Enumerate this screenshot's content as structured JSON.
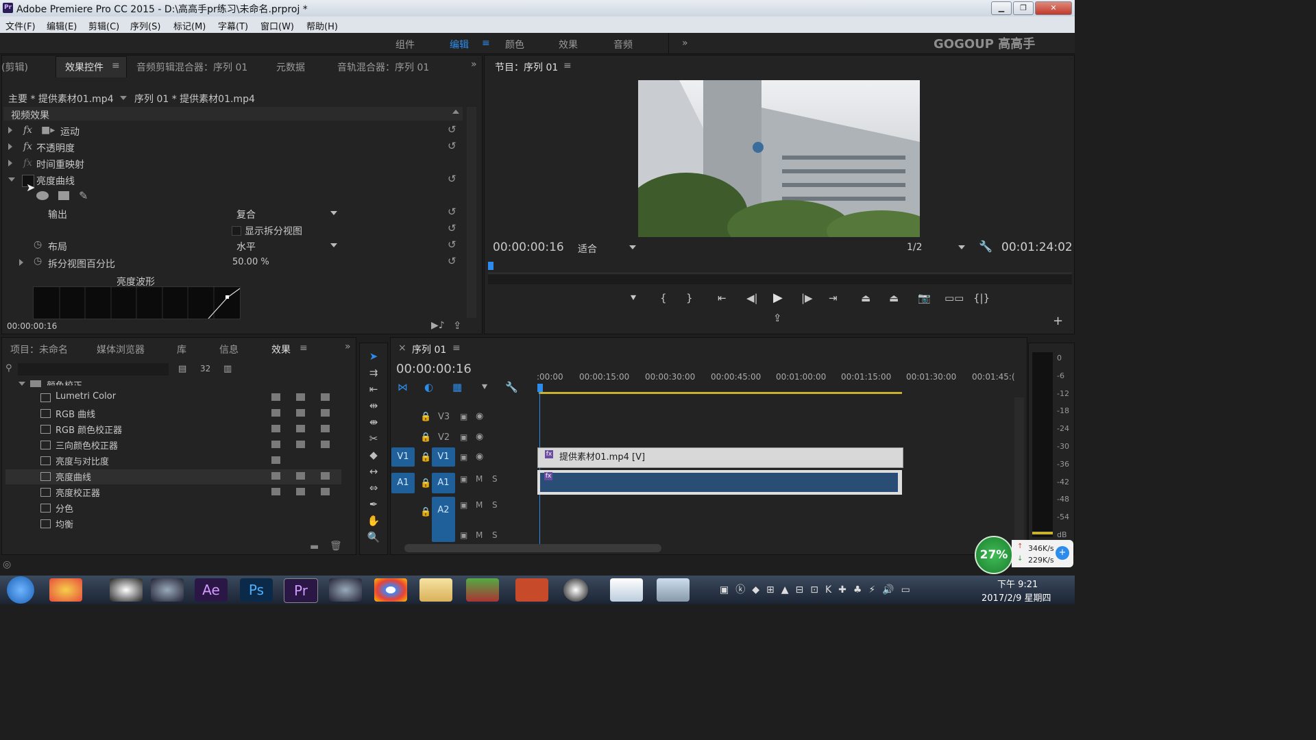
{
  "window": {
    "app_icon": "Pr",
    "title": "Adobe Premiere Pro CC 2015 - D:\\高高手pr练习\\未命名.prproj *",
    "controls": [
      "minimize-icon",
      "restore-icon",
      "close-icon"
    ]
  },
  "menu": [
    "文件(F)",
    "编辑(E)",
    "剪辑(C)",
    "序列(S)",
    "标记(M)",
    "字幕(T)",
    "窗口(W)",
    "帮助(H)"
  ],
  "workspaces": {
    "items": [
      "组件",
      "编辑",
      "颜色",
      "效果",
      "音频"
    ],
    "active": "编辑",
    "overflow": "»",
    "logo": "GOGOUP 高高手"
  },
  "effect_controls": {
    "tabs": [
      "(剪辑)",
      "效果控件",
      "音频剪辑混合器：序列 01",
      "元数据",
      "音轨混合器：序列 01"
    ],
    "selected_tab": "效果控件",
    "overflow": "»",
    "master_clip": "主要 * 提供素材01.mp4",
    "sequence_clip": "序列 01 * 提供素材01.mp4",
    "section": "视频效果",
    "effects": [
      "运动",
      "不透明度",
      "时间重映射",
      "亮度曲线"
    ],
    "fx_label": "fx",
    "props": {
      "output_label": "输出",
      "output_value": "复合",
      "split_view_label": "显示拆分视图",
      "layout_label": "布局",
      "layout_value": "水平",
      "split_percent_label": "拆分视图百分比",
      "split_percent_value": "50.00 %",
      "waveform_label": "亮度波形"
    },
    "timecode": "00:00:00:16"
  },
  "program_monitor": {
    "title": "节目：序列 01",
    "timecode": "00:00:00:16",
    "fit": "适合",
    "resolution": "1/2",
    "duration": "00:01:24:02"
  },
  "project_panel": {
    "tabs": [
      "项目：未命名",
      "媒体浏览器",
      "库",
      "信息",
      "效果"
    ],
    "selected_tab": "效果",
    "overflow": "»",
    "folder": "颜色校正",
    "items": [
      "Lumetri Color",
      "RGB 曲线",
      "RGB 颜色校正器",
      "三向颜色校正器",
      "亮度与对比度",
      "亮度曲线",
      "亮度校正器",
      "分色",
      "均衡"
    ],
    "selected_item": "亮度曲线"
  },
  "timeline": {
    "title": "序列 01",
    "timecode": "00:00:00:16",
    "ruler": [
      ":00:00",
      "00:00:15:00",
      "00:00:30:00",
      "00:00:45:00",
      "00:01:00:00",
      "00:01:15:00",
      "00:01:30:00",
      "00:01:45:("
    ],
    "tracks": {
      "v3": "V3",
      "v2": "V2",
      "v1_src": "V1",
      "v1": "V1",
      "a1_src": "A1",
      "a1": "A1",
      "a2": "A2",
      "m": "M",
      "s": "S"
    },
    "clip_v1": "提供素材01.mp4 [V]",
    "meter_scale": [
      "0",
      "-6",
      "-12",
      "-18",
      "-24",
      "-30",
      "-36",
      "-42",
      "-48",
      "-54",
      "dB"
    ]
  },
  "status": {
    "network_percent": "27%",
    "upload": "346K/s",
    "download": "229K/s"
  },
  "taskbar": {
    "apps": [
      "start-icon",
      "colors-icon",
      "qq-icon",
      "c4d-icon",
      "Ae",
      "Ps",
      "Pr",
      "c4d2-icon",
      "chrome-icon",
      "explorer-icon",
      "media-icon",
      "ppt-icon",
      "obs-icon",
      "notes-icon",
      "paint-icon"
    ],
    "time": "下午 9:21",
    "date": "2017/2/9 星期四"
  },
  "colors": {
    "accent": "#2d8ceb",
    "track_badge": "#1f5f9a",
    "clip_video": "#d8d8d8",
    "clip_audio": "#2a4d75"
  }
}
